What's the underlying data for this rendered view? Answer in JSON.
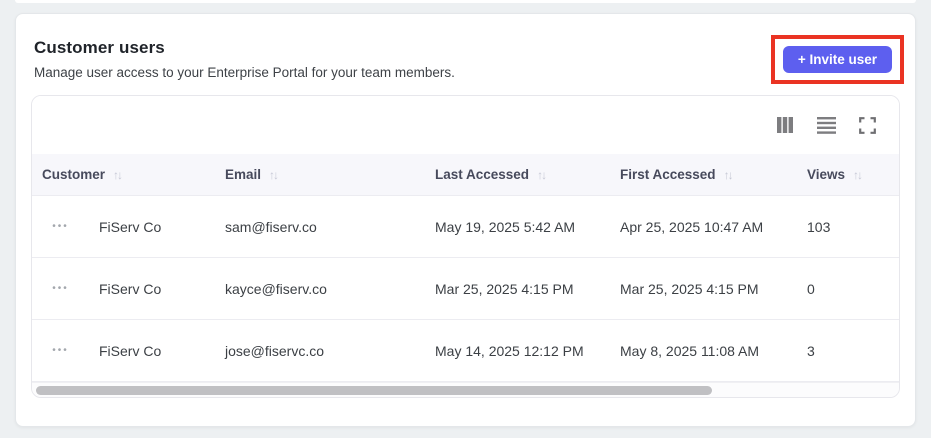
{
  "header": {
    "title": "Customer users",
    "subtitle": "Manage user access to your Enterprise Portal for your team members.",
    "invite_button": "+ Invite user"
  },
  "table": {
    "columns": [
      {
        "label": "Customer",
        "sortable": true
      },
      {
        "label": "Email",
        "sortable": true
      },
      {
        "label": "Last Accessed",
        "sortable": true
      },
      {
        "label": "First Accessed",
        "sortable": true
      },
      {
        "label": "Views",
        "sortable": true
      }
    ],
    "rows": [
      {
        "customer": "FiServ Co",
        "email": "sam@fiserv.co",
        "last_accessed": "May 19, 2025 5:42 AM",
        "first_accessed": "Apr 25, 2025 10:47 AM",
        "views": "103"
      },
      {
        "customer": "FiServ Co",
        "email": "kayce@fiserv.co",
        "last_accessed": "Mar 25, 2025 4:15 PM",
        "first_accessed": "Mar 25, 2025 4:15 PM",
        "views": "0"
      },
      {
        "customer": "FiServ Co",
        "email": "jose@fiservc.co",
        "last_accessed": "May 14, 2025 12:12 PM",
        "first_accessed": "May 8, 2025 11:08 AM",
        "views": "3"
      }
    ]
  },
  "icons": {
    "sort_glyph": "↑↓",
    "row_menu_glyph": "•••"
  },
  "scrollbar": {
    "thumb_percent": 78
  },
  "colors": {
    "accent": "#5d5fef",
    "annotation_red": "#ea3323",
    "page_bg": "#edf0f2",
    "table_header_bg": "#f7f7fb"
  }
}
